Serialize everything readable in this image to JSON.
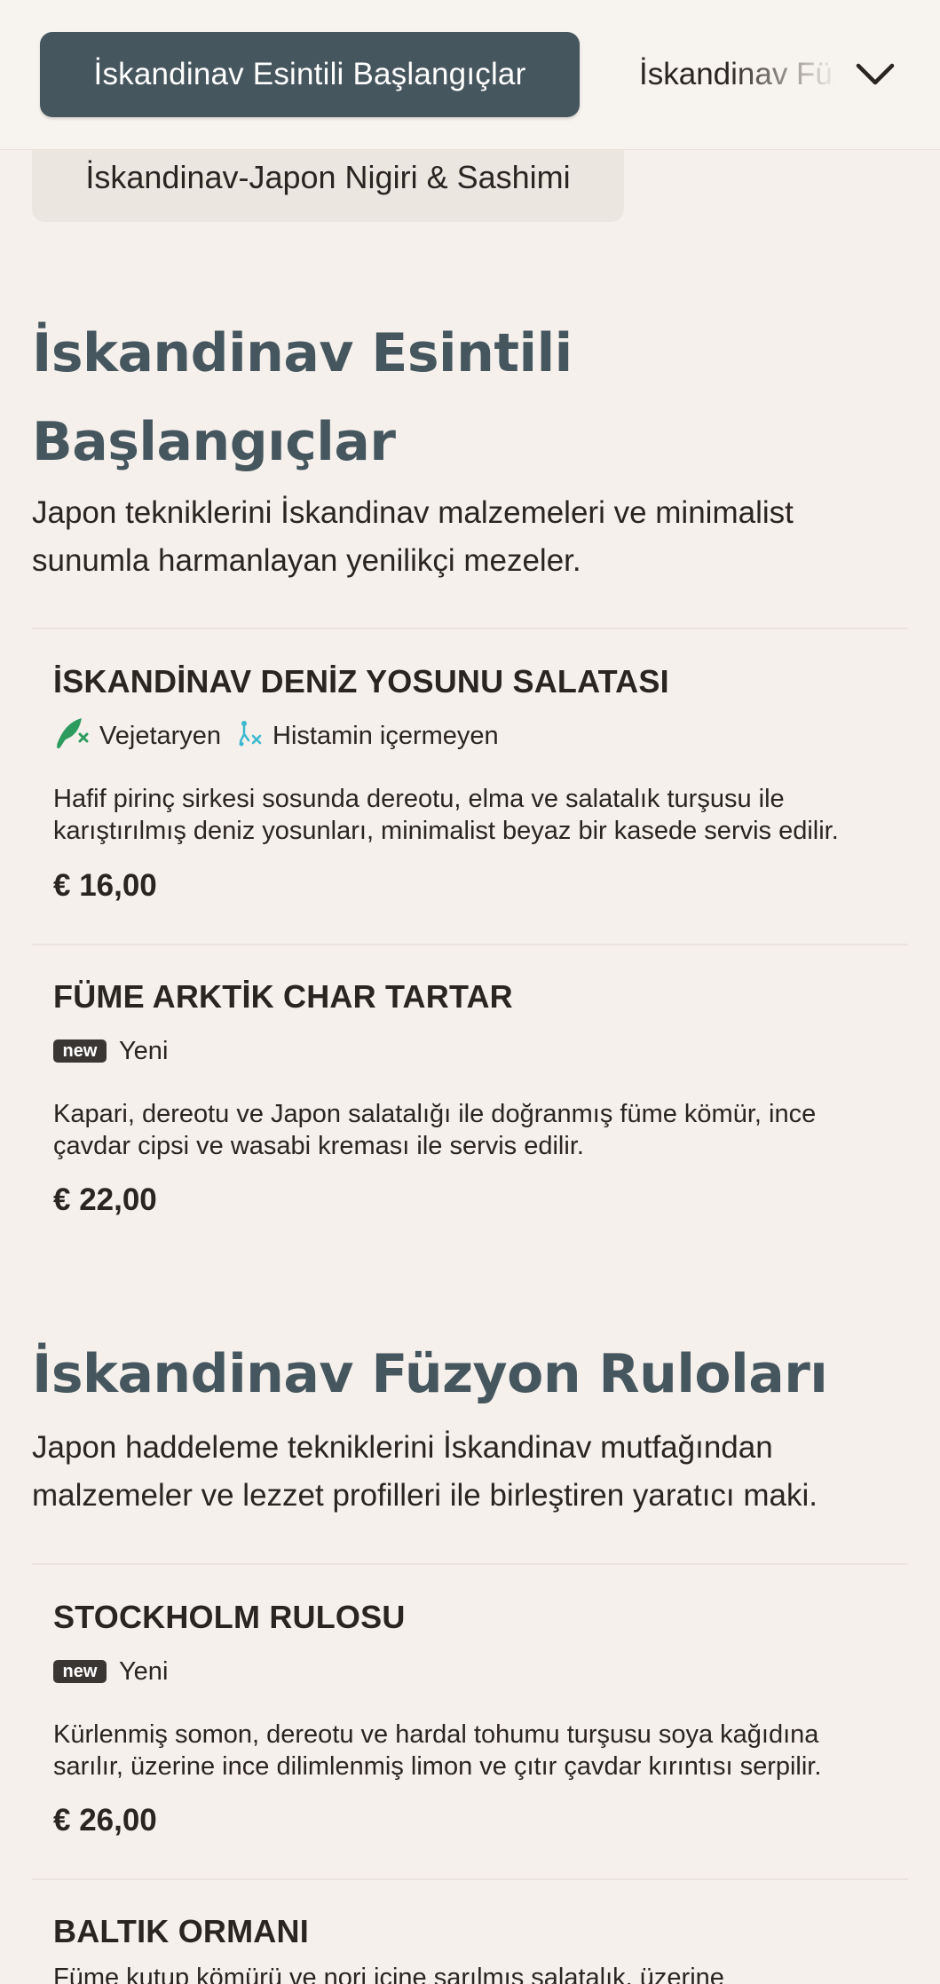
{
  "topbar": {
    "active_tab": "İskandinav Esintili Başlangıçlar",
    "next_tab": "İskandinav Füzyon Ruloları",
    "scrolled_pill": "İskandinav-Japon Nigiri & Sashimi"
  },
  "sections": [
    {
      "title_line1": "İskandinav Esintili",
      "title_line2": "Başlangıçlar",
      "description_line1": "Japon tekniklerini İskandinav malzemeleri ve minimalist",
      "description_line2": "sunumla harmanlayan yenilikçi mezeler.",
      "items": [
        {
          "name": "İSKANDİNAV DENİZ YOSUNU SALATASI",
          "tags": [
            {
              "icon": "vegetarian-icon",
              "label": "Vejetaryen"
            },
            {
              "icon": "histamine-free-icon",
              "label": "Histamin içermeyen"
            }
          ],
          "description": "Hafif pirinç sirkesi sosunda dereotu, elma ve salatalık turşusu ile karıştırılmış deniz yosunları, minimalist beyaz bir kasede servis edilir.",
          "price": "€ 16,00"
        },
        {
          "name": "FÜME ARKTİK CHAR TARTAR",
          "badge": "new",
          "badge_label": "Yeni",
          "description": "Kapari, dereotu ve Japon salatalığı ile doğranmış füme kömür, ince çavdar cipsi ve wasabi kreması ile servis edilir.",
          "price": "€ 22,00"
        }
      ]
    },
    {
      "title_line1": "İskandinav Füzyon Ruloları",
      "description_line1": "Japon haddeleme tekniklerini İskandinav mutfağından",
      "description_line2": "malzemeler ve lezzet profilleri ile birleştiren yaratıcı maki.",
      "items": [
        {
          "name": "STOCKHOLM RULOSU",
          "badge": "new",
          "badge_label": "Yeni",
          "description": "Kürlenmiş somon, dereotu ve hardal tohumu turşusu soya kağıdına sarılır, üzerine ince dilimlenmiş limon ve çıtır çavdar kırıntısı serpilir.",
          "price": "€ 26,00"
        },
        {
          "name": "BALTIK ORMANI",
          "description": "Füme kutup kömürü ve nori içine sarılmış salatalık, üzerine"
        }
      ]
    }
  ],
  "colors": {
    "background": "#f5f0eb",
    "accent": "#46565f",
    "vegetarian_icon": "#2e9b5e",
    "histamine_icon": "#3bb8d0"
  }
}
